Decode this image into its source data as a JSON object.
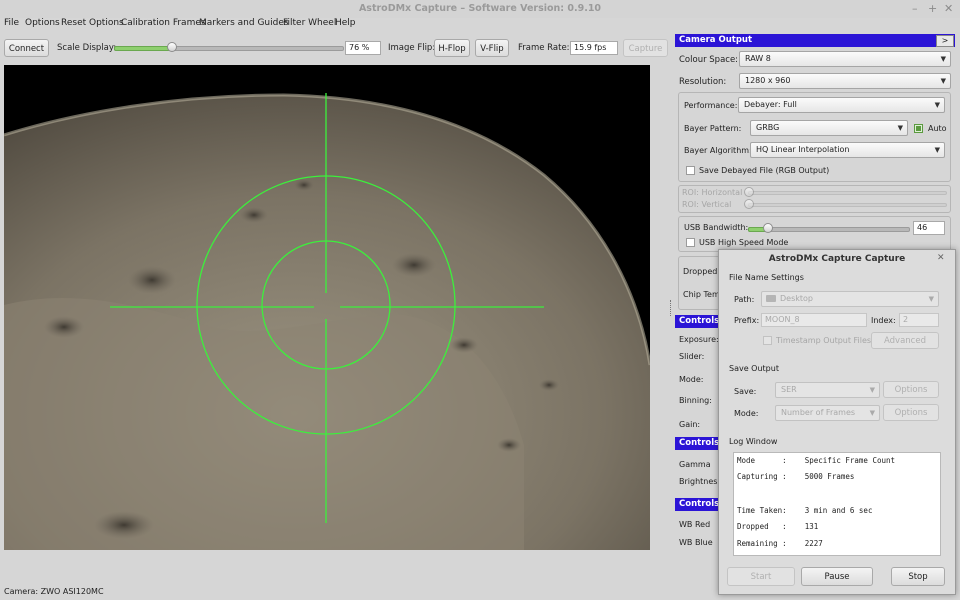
{
  "app": {
    "title": "AstroDMx Capture – Software Version: 0.9.10",
    "window_controls": {
      "minimize": "–",
      "maximize": "+",
      "close": "✕"
    }
  },
  "menu": [
    "File",
    "Options",
    "Reset Options",
    "Calibration Frames",
    "Markers and Guides",
    "Filter Wheel",
    "Help"
  ],
  "toolbar": {
    "connect": "Connect",
    "scale_label": "Scale Display:",
    "scale_value": "76 %",
    "scale_fraction": 0.76,
    "flip_label": "Image Flip:",
    "hflop": "H-Flop",
    "vflip": "V-Flip",
    "frame_rate_label": "Frame Rate:",
    "frame_rate": "15.9 fps",
    "capture": "Capture"
  },
  "camera_output": {
    "header": "Camera Output",
    "header_button": ">",
    "colour_space_label": "Colour Space:",
    "colour_space": "RAW 8",
    "resolution_label": "Resolution:",
    "resolution": "1280 x 960",
    "performance_label": "Performance:",
    "performance": "Debayer: Full",
    "bayer_pattern_label": "Bayer Pattern:",
    "bayer_pattern": "GRBG",
    "auto_label": "Auto",
    "bayer_algorithm_label": "Bayer Algorithm:",
    "bayer_algorithm": "HQ Linear Interpolation",
    "save_debayered": "Save Debayed File (RGB Output)",
    "roi_h": "ROI: Horizontal",
    "roi_v": "ROI: Vertical",
    "usb_bandwidth_label": "USB Bandwidth:",
    "usb_bandwidth": "46",
    "usb_high_speed": "USB High Speed Mode",
    "dropped_label": "Dropped",
    "chip_temp_label": "Chip Tem"
  },
  "controls": {
    "header1": "Controls: I",
    "exposure": "Exposure:",
    "slider": "Slider:",
    "mode": "Mode:",
    "binning": "Binning:",
    "gain": "Gain:",
    "header2": "Controls: I",
    "gamma": "Gamma",
    "brightness": "Brightnes",
    "header3": "Controls: (",
    "wb_red": "WB Red",
    "wb_blue": "WB Blue"
  },
  "dialog": {
    "title": "AstroDMx Capture Capture",
    "close": "✕",
    "file_name_settings": "File Name Settings",
    "path_label": "Path:",
    "path": "Desktop",
    "prefix_label": "Prefix:",
    "prefix": "MOON_8",
    "index_label": "Index:",
    "index": "2",
    "timestamp": "Timestamp Output Files",
    "advanced": "Advanced",
    "save_output": "Save Output",
    "save_label": "Save:",
    "save_value": "SER",
    "options": "Options",
    "mode_label": "Mode:",
    "mode_value": "Number of Frames",
    "log_window": "Log Window",
    "log": [
      "Mode      :    Specific Frame Count",
      "Capturing :    5000 Frames",
      "",
      "Time Taken:    3 min and 6 sec",
      "Dropped   :    131",
      "Remaining :    2227"
    ],
    "start": "Start",
    "pause": "Pause",
    "stop": "Stop"
  },
  "status": "Camera: ZWO ASI120MC",
  "colors": {
    "accent": "#2b14d6",
    "reticle": "#3cf03c",
    "slider_fill": "#8ecf6e"
  }
}
